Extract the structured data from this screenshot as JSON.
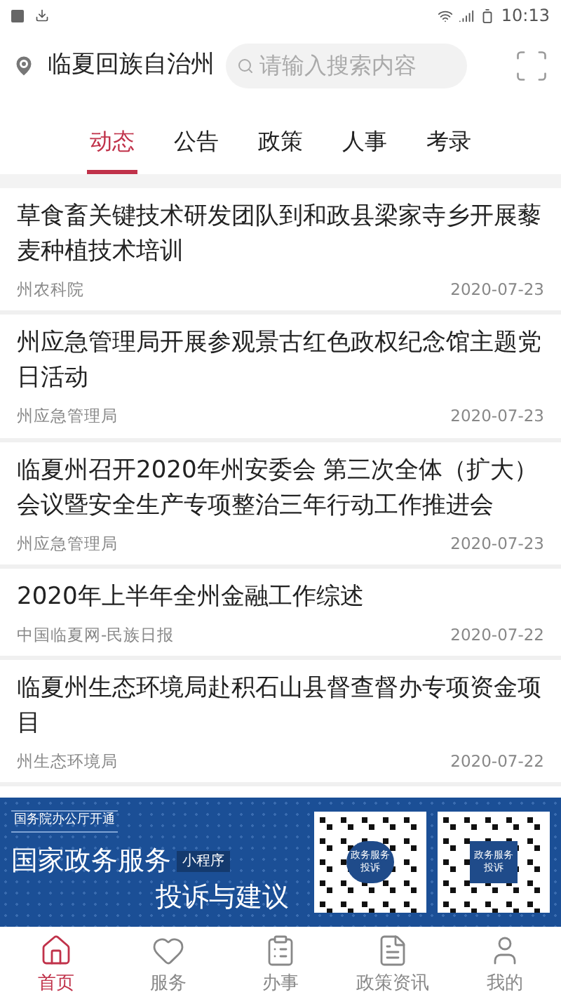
{
  "status_bar": {
    "time": "10:13"
  },
  "header": {
    "location": "临夏回族自治州",
    "search": {
      "placeholder": "请输入搜索内容"
    }
  },
  "tabs": [
    {
      "label": "动态",
      "selected": true
    },
    {
      "label": "公告",
      "selected": false
    },
    {
      "label": "政策",
      "selected": false
    },
    {
      "label": "人事",
      "selected": false
    },
    {
      "label": "考录",
      "selected": false
    }
  ],
  "news": [
    {
      "title": "草食畜关键技术研发团队到和政县梁家寺乡开展藜麦种植技术培训",
      "source": "州农科院",
      "date": "2020-07-23"
    },
    {
      "title": "州应急管理局开展参观景古红色政权纪念馆主题党日活动",
      "source": "州应急管理局",
      "date": "2020-07-23"
    },
    {
      "title": "临夏州召开2020年州安委会 第三次全体（扩大）会议暨安全生产专项整治三年行动工作推进会",
      "source": "州应急管理局",
      "date": "2020-07-23"
    },
    {
      "title": "2020年上半年全州金融工作综述",
      "source": "中国临夏网-民族日报",
      "date": "2020-07-22"
    },
    {
      "title": "临夏州生态环境局赴积石山县督查督办专项资金项目",
      "source": "州生态环境局",
      "date": "2020-07-22"
    }
  ],
  "banner": {
    "kicker": "国务院办公厅开通",
    "title": "国家政务服务",
    "badge": "小程序",
    "subtitle": "投诉与建议",
    "qr_labels": [
      "政务服务投诉",
      "政务服务投诉"
    ]
  },
  "bottom_nav": [
    {
      "label": "首页",
      "selected": true
    },
    {
      "label": "服务",
      "selected": false
    },
    {
      "label": "办事",
      "selected": false
    },
    {
      "label": "政策资讯",
      "selected": false
    },
    {
      "label": "我的",
      "selected": false
    }
  ]
}
